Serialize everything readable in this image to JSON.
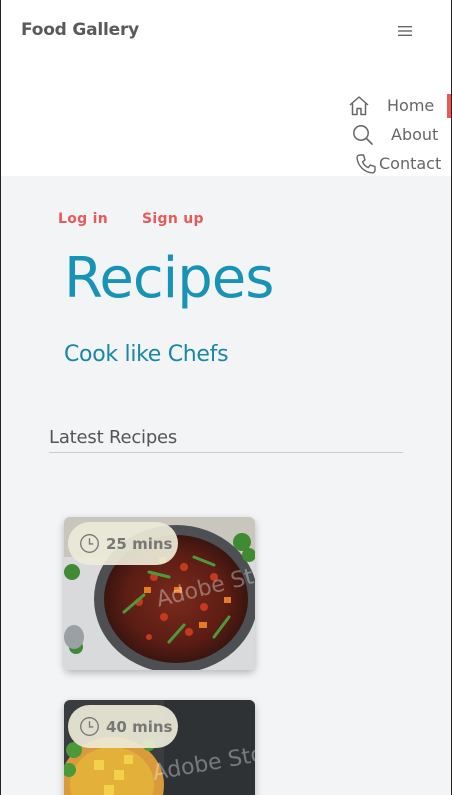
{
  "header": {
    "brand": "Food Gallery",
    "menu_icon": "hamburger-icon"
  },
  "nav": {
    "items": [
      {
        "label": "Home",
        "icon": "home-icon",
        "active": true
      },
      {
        "label": "About",
        "icon": "search-icon",
        "active": false
      },
      {
        "label": "Contact",
        "icon": "phone-icon",
        "active": false
      }
    ]
  },
  "auth": {
    "login": "Log in",
    "signup": "Sign up"
  },
  "hero": {
    "title": "Recipes",
    "subtitle": "Cook like Chefs"
  },
  "section": {
    "title": "Latest Recipes"
  },
  "recipes": [
    {
      "time": "25 mins",
      "icon": "clock-icon",
      "image": "chili-bean-bowl"
    },
    {
      "time": "40 mins",
      "icon": "clock-icon",
      "image": "curry-bowl"
    }
  ],
  "colors": {
    "accent": "#e85a5a",
    "title": "#1793b5",
    "subtitle": "#1a86a8",
    "background": "#f2f4f6"
  }
}
